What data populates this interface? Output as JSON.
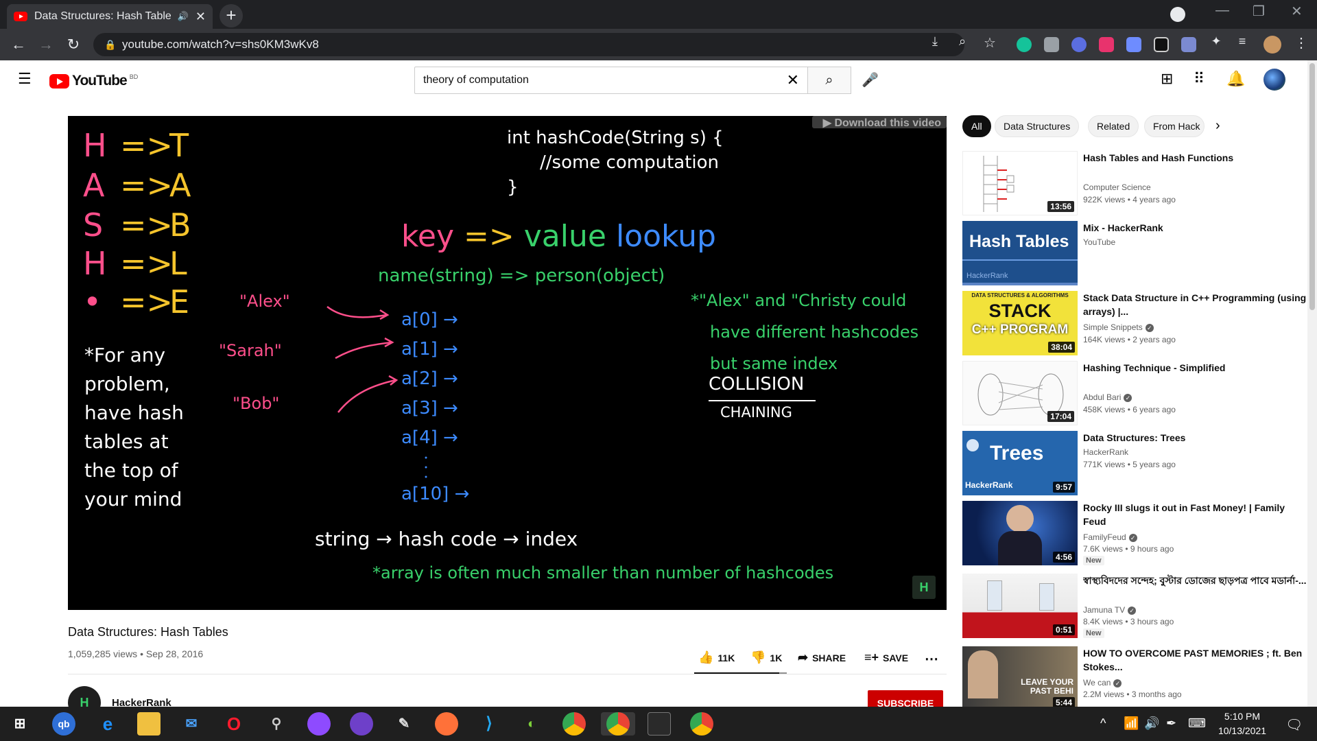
{
  "browser": {
    "tab_title": "Data Structures: Hash Tables",
    "url": "youtube.com/watch?v=shs0KM3wKv8"
  },
  "youtube": {
    "logo_text": "YouTube",
    "country_code": "BD",
    "search_query": "theory of computation"
  },
  "video": {
    "overlay_button": "▶ Download this video",
    "board": {
      "mnemonic": [
        {
          "left": "H",
          "arrow": "=>",
          "right": "T"
        },
        {
          "left": "A",
          "arrow": "=>",
          "right": "A"
        },
        {
          "left": "S",
          "arrow": "=>",
          "right": "B"
        },
        {
          "left": "H",
          "arrow": "=>",
          "right": "L"
        },
        {
          "left": "•",
          "arrow": "=>",
          "right": "E"
        }
      ],
      "tip": [
        "*For any",
        "problem,",
        "have hash",
        "tables at",
        "the top of",
        "your mind"
      ],
      "code": [
        "int hashCode(String s) {",
        "//some computation",
        "}"
      ],
      "heading": {
        "key": "key",
        "arrow": "=>",
        "value": "value",
        "lookup": "lookup"
      },
      "name_line": "name(string) => person(object)",
      "names": [
        "\"Alex\"",
        "\"Sarah\"",
        "\"Bob\""
      ],
      "array": [
        "a[0] →",
        "a[1] →",
        "a[2] →",
        "a[3] →",
        "a[4] →",
        "a[10] →"
      ],
      "note": [
        "*\"Alex\" and \"Christy could",
        "have different hashcodes",
        "but same index"
      ],
      "collision": "COLLISION",
      "chaining": "CHAINING",
      "flow": "string → hash code → index",
      "footnote": "*array is often much smaller than number of hashcodes"
    },
    "title": "Data Structures: Hash Tables",
    "views": "1,059,285 views",
    "date": "Sep 28, 2016",
    "likes": "11K",
    "dislikes": "1K",
    "like_ratio": 0.92,
    "share": "SHARE",
    "save": "SAVE",
    "channel": "HackerRank",
    "subscribe": "SUBSCRIBE"
  },
  "chips": [
    "All",
    "Data Structures",
    "Related",
    "From Hack"
  ],
  "recommendations": [
    {
      "title": "Hash Tables and Hash Functions",
      "channel": "Computer Science",
      "views": "922K views • 4 years ago",
      "duration": "13:56"
    },
    {
      "title": "Mix - HackerRank",
      "channel": "YouTube",
      "views": "",
      "duration": ""
    },
    {
      "title": "Stack Data Structure in C++ Programming (using arrays) |...",
      "channel": "Simple Snippets",
      "views": "164K views • 2 years ago",
      "duration": "38:04"
    },
    {
      "title": "Hashing Technique - Simplified",
      "channel": "Abdul Bari",
      "views": "458K views • 6 years ago",
      "duration": "17:04"
    },
    {
      "title": "Data Structures: Trees",
      "channel": "HackerRank",
      "views": "771K views • 5 years ago",
      "duration": "9:57"
    },
    {
      "title": "Rocky III slugs it out in Fast Money! | Family Feud",
      "channel": "FamilyFeud",
      "views": "7.6K views • 9 hours ago",
      "duration": "4:56",
      "badge": "New"
    },
    {
      "title": "স্বাস্থ্যবিদদের সন্দেহ; বুস্টার ডোজের ছাড়পত্র পাবে মডার্না-...",
      "channel": "Jamuna TV",
      "views": "8.4K views • 3 hours ago",
      "duration": "0:51",
      "badge": "New"
    },
    {
      "title": "HOW TO OVERCOME PAST MEMORIES ; ft. Ben Stokes...",
      "channel": "We can",
      "views": "2.2M views • 3 months ago",
      "duration": "5:44"
    }
  ],
  "thumb_text": {
    "hash_tables": "Hash Tables",
    "hackerrank": "HackerRank",
    "stack_top": "DATA STRUCTURES & ALGORITHMS",
    "stack_main": "STACK",
    "stack_sub": "C++ PROGRAM",
    "trees": "Trees",
    "leave": "LEAVE YOUR PAST BEHI"
  },
  "taskbar": {
    "time": "5:10 PM",
    "date": "10/13/2021"
  },
  "colors": {
    "yt_red": "#ff0000",
    "pink": "#ff4f8b",
    "yellow": "#f5c42c",
    "green": "#39d16b",
    "blue": "#3d8bff"
  }
}
